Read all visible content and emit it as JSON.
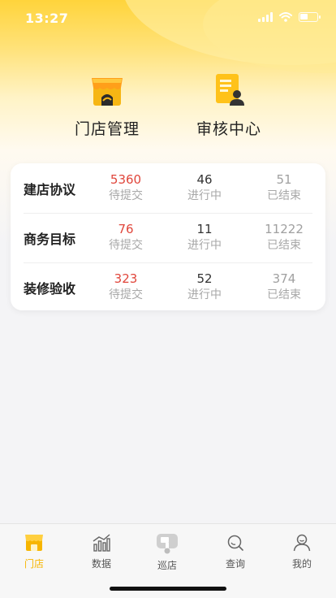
{
  "status": {
    "time": "13:27"
  },
  "shortcuts": [
    {
      "label": "门店管理",
      "icon": "store-icon"
    },
    {
      "label": "审核中心",
      "icon": "document-review-icon"
    }
  ],
  "stats": {
    "rows": [
      {
        "title": "建店协议",
        "pending": "5360",
        "in_progress": "46",
        "finished": "51"
      },
      {
        "title": "商务目标",
        "pending": "76",
        "in_progress": "11",
        "finished": "11222"
      },
      {
        "title": "装修验收",
        "pending": "323",
        "in_progress": "52",
        "finished": "374"
      }
    ],
    "captions": {
      "pending": "待提交",
      "in_progress": "进行中",
      "finished": "已结束"
    },
    "colors": {
      "pending": "#e0463b",
      "in_progress": "#333333",
      "finished": "#a0a0a0"
    }
  },
  "tabbar": {
    "items": [
      {
        "label": "门店",
        "icon": "store-icon",
        "active": true
      },
      {
        "label": "数据",
        "icon": "bar-chart-icon",
        "active": false
      },
      {
        "label": "巡店",
        "icon": "patrol-van-icon",
        "active": false
      },
      {
        "label": "查询",
        "icon": "search-icon",
        "active": false
      },
      {
        "label": "我的",
        "icon": "user-icon",
        "active": false
      }
    ],
    "active_color": "#f7b500"
  },
  "theme": {
    "accent": "#ffd43b"
  }
}
